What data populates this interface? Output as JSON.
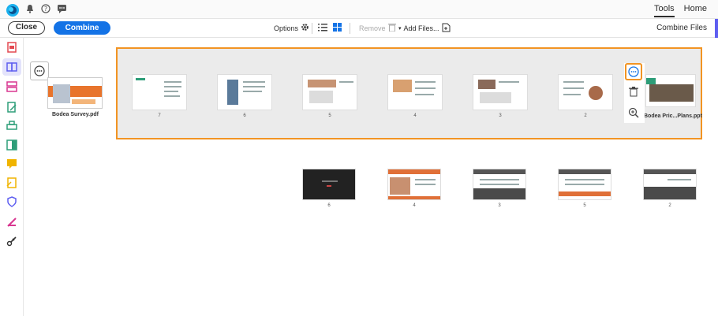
{
  "topbar": {
    "tabs": [
      {
        "label": "Home"
      },
      {
        "label": "Tools"
      }
    ],
    "icons": [
      "app-logo-icon",
      "bell-icon",
      "help-icon",
      "chat-icon"
    ]
  },
  "toolbar": {
    "close_label": "Close",
    "combine_label": "Combine",
    "options_label": "Options",
    "add_files_label": "Add Files...",
    "remove_label": "Remove",
    "title": "Combine Files"
  },
  "files": {
    "bodea_survey": {
      "label": "Bodea Survey.pdf"
    },
    "bodea_pricing": {
      "label": "Bodea Pric...Plans.ppt"
    }
  },
  "expanded_pages": [
    "7",
    "6",
    "5",
    "4",
    "3",
    "2"
  ],
  "lower_pages": [
    "6",
    "4",
    "3",
    "5",
    "2"
  ],
  "colors": {
    "accent": "#1473e6",
    "highlight": "#f29423",
    "sidebar_active": "#5e5ef0"
  }
}
